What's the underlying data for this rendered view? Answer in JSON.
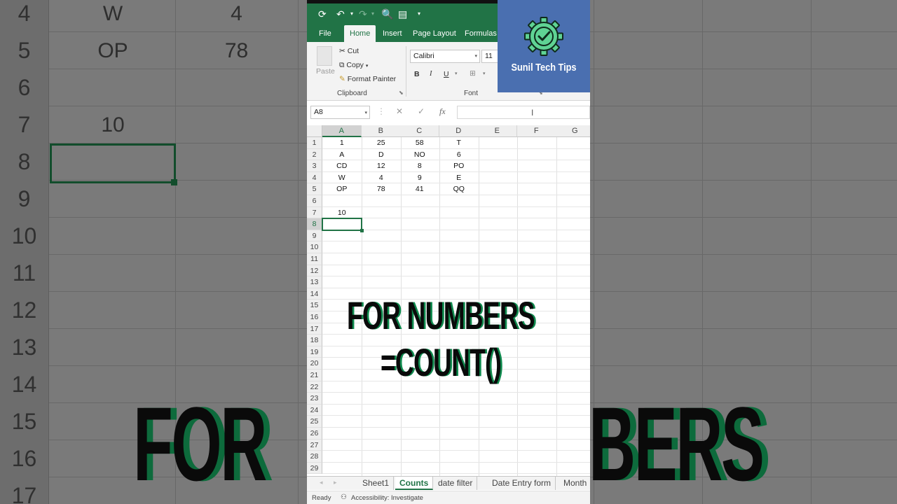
{
  "background": {
    "rows": [
      {
        "num": "4",
        "b": "W",
        "c": "4"
      },
      {
        "num": "5",
        "b": "OP",
        "c": "78"
      },
      {
        "num": "6",
        "b": "",
        "c": ""
      },
      {
        "num": "7",
        "b": "10",
        "c": ""
      },
      {
        "num": "8",
        "b": "",
        "c": ""
      },
      {
        "num": "9",
        "b": "",
        "c": ""
      },
      {
        "num": "10",
        "b": "",
        "c": ""
      },
      {
        "num": "11",
        "b": "",
        "c": ""
      },
      {
        "num": "12",
        "b": "",
        "c": ""
      },
      {
        "num": "13",
        "b": "",
        "c": ""
      },
      {
        "num": "14",
        "b": "",
        "c": ""
      },
      {
        "num": "15",
        "b": "",
        "c": ""
      },
      {
        "num": "16",
        "b": "",
        "c": ""
      },
      {
        "num": "17",
        "b": "",
        "c": ""
      }
    ],
    "big_text_left": "FOR",
    "big_text_right": "BERS"
  },
  "ribbon": {
    "tabs": [
      "File",
      "Home",
      "Insert",
      "Page Layout",
      "Formulas"
    ],
    "active_tab": "Home",
    "clipboard": {
      "paste": "Paste",
      "cut": "Cut",
      "copy": "Copy",
      "format_painter": "Format Painter",
      "group_label": "Clipboard"
    },
    "font": {
      "name": "Calibri",
      "size": "11",
      "bold": "B",
      "italic": "I",
      "underline": "U",
      "group_label": "Font"
    }
  },
  "formula_bar": {
    "name_box": "A8",
    "cancel": "✕",
    "enter": "✓",
    "fx": "fx",
    "value": ""
  },
  "grid": {
    "columns": [
      "A",
      "B",
      "C",
      "D",
      "E",
      "F",
      "G"
    ],
    "selected_column": "A",
    "selected_row": "8",
    "row_numbers": [
      "1",
      "2",
      "3",
      "4",
      "5",
      "6",
      "7",
      "8",
      "9",
      "10",
      "11",
      "12",
      "13",
      "14",
      "15",
      "16",
      "17",
      "18",
      "19",
      "20",
      "21",
      "22",
      "23",
      "24",
      "25",
      "26",
      "27",
      "28",
      "29"
    ],
    "cells": [
      [
        "1",
        "25",
        "58",
        "T"
      ],
      [
        "A",
        "D",
        "NO",
        "6"
      ],
      [
        "CD",
        "12",
        "8",
        "PO"
      ],
      [
        "W",
        "4",
        "9",
        "E"
      ],
      [
        "OP",
        "78",
        "41",
        "QQ"
      ],
      [
        "",
        "",
        "",
        ""
      ],
      [
        "10",
        "",
        "",
        ""
      ]
    ]
  },
  "sheets": {
    "tabs": [
      "Sheet1",
      "Counts",
      "date filter",
      "Date Entry form",
      "Month"
    ],
    "active": "Counts"
  },
  "status": {
    "ready": "Ready",
    "accessibility": "Accessibility: Investigate"
  },
  "overlay": {
    "line1": "FOR NUMBERS",
    "line2": "=COUNT()"
  },
  "badge": {
    "text": "Sunil Tech Tips",
    "color": "#4a6fb0"
  },
  "colors": {
    "excel_green": "#217346",
    "accent_green": "#0f8a4e"
  }
}
